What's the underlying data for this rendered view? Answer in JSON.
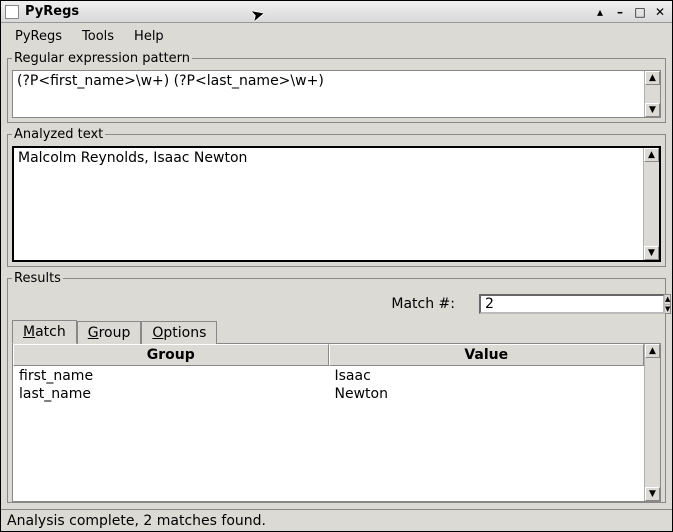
{
  "window": {
    "title": "PyRegs"
  },
  "menubar": {
    "items": [
      "PyRegs",
      "Tools",
      "Help"
    ]
  },
  "sections": {
    "pattern": {
      "legend": "Regular expression pattern",
      "value": "(?P<first_name>\\w+) (?P<last_name>\\w+)"
    },
    "analyzed": {
      "legend": "Analyzed text",
      "value": "Malcolm Reynolds, Isaac Newton"
    },
    "results": {
      "legend": "Results",
      "match_label": "Match #:",
      "match_value": "2",
      "tabs": [
        {
          "label": "Match",
          "accel_index": 0
        },
        {
          "label": "Group",
          "accel_index": 0
        },
        {
          "label": "Options",
          "accel_index": 0
        }
      ],
      "columns": [
        "Group",
        "Value"
      ],
      "rows": [
        {
          "group": "first_name",
          "value": "Isaac"
        },
        {
          "group": "last_name",
          "value": "Newton"
        }
      ]
    }
  },
  "statusbar": "Analysis complete, 2 matches found."
}
